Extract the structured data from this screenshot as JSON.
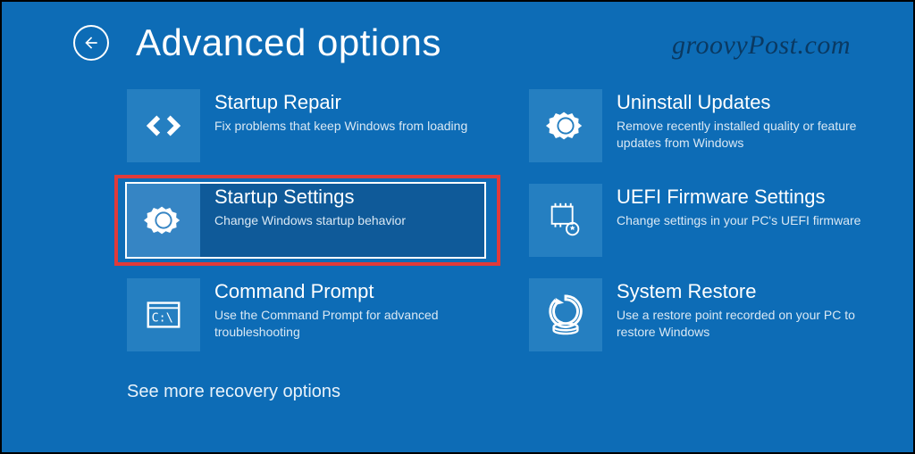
{
  "header": {
    "title": "Advanced options"
  },
  "watermark": "groovyPost.com",
  "tiles": {
    "startup_repair": {
      "title": "Startup Repair",
      "desc": "Fix problems that keep Windows from loading"
    },
    "uninstall_updates": {
      "title": "Uninstall Updates",
      "desc": "Remove recently installed quality or feature updates from Windows"
    },
    "startup_settings": {
      "title": "Startup Settings",
      "desc": "Change Windows startup behavior"
    },
    "uefi_firmware": {
      "title": "UEFI Firmware Settings",
      "desc": "Change settings in your PC's UEFI firmware"
    },
    "command_prompt": {
      "title": "Command Prompt",
      "desc": "Use the Command Prompt for advanced troubleshooting"
    },
    "system_restore": {
      "title": "System Restore",
      "desc": "Use a restore point recorded on your PC to restore Windows"
    }
  },
  "footer": {
    "link": "See more recovery options"
  }
}
